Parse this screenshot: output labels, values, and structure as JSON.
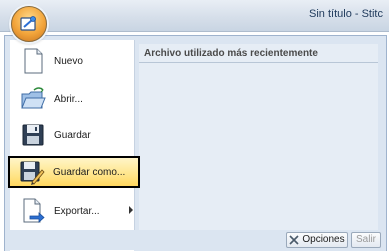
{
  "window": {
    "title": "Sin título - Stitc"
  },
  "app_button": {
    "icon": "app-menu-icon"
  },
  "menu": {
    "items": [
      {
        "label": "Nuevo",
        "icon": "new-document-icon"
      },
      {
        "label": "Abrir...",
        "icon": "open-folder-icon"
      },
      {
        "label": "Guardar",
        "icon": "save-disk-icon"
      },
      {
        "label": "Guardar como...",
        "icon": "save-as-icon",
        "highlighted": true
      },
      {
        "label": "Exportar...",
        "icon": "export-icon",
        "has_submenu": true
      }
    ]
  },
  "recent": {
    "header": "Archivo utilizado más recientemente"
  },
  "footer": {
    "options_label": "Opciones",
    "exit_label": "Salir"
  },
  "colors": {
    "highlight": "#ffe58a",
    "highlight_border": "#000000",
    "pane_bg": "#e6edf5",
    "frame": "#dbe5f1",
    "title_text": "#1e395b"
  }
}
